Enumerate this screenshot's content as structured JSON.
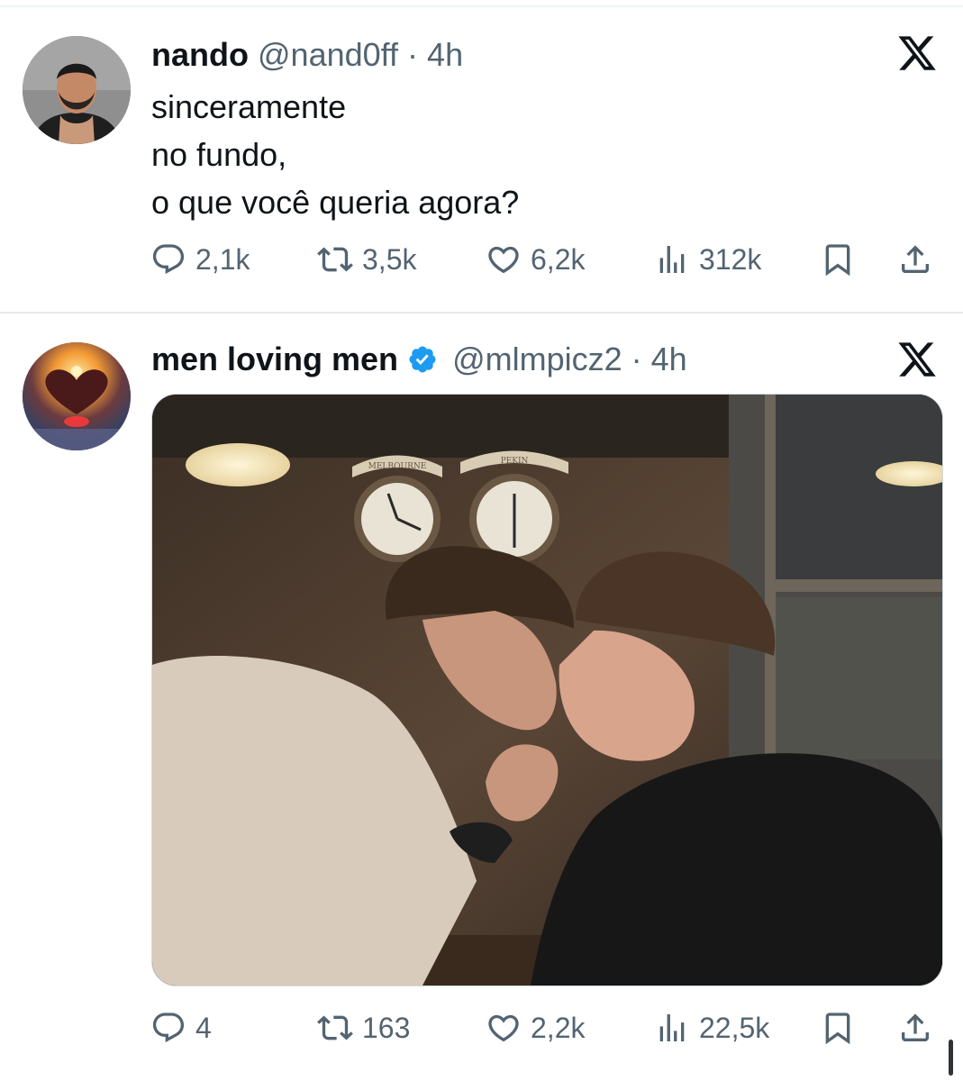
{
  "tweets": [
    {
      "author_name": "nando",
      "handle": "@nand0ff",
      "separator": "·",
      "time": "4h",
      "verified": false,
      "text_lines": [
        "sinceramente",
        "no fundo,",
        "o que você queria agora?"
      ],
      "stats": {
        "replies": "2,1k",
        "retweets": "3,5k",
        "likes": "6,2k",
        "views": "312k"
      }
    },
    {
      "author_name": "men loving men",
      "handle": "@mlmpicz2",
      "separator": "·",
      "time": "4h",
      "verified": true,
      "media": {
        "description_icon": "photo-icon",
        "clock_labels": [
          "MELBOURNE",
          "PEKIN"
        ]
      },
      "stats": {
        "replies": "4",
        "retweets": "163",
        "likes": "2,2k",
        "views": "22,5k"
      }
    }
  ],
  "icons": {
    "reply": "reply-icon",
    "retweet": "retweet-icon",
    "like": "heart-icon",
    "views": "views-icon",
    "bookmark": "bookmark-icon",
    "share": "share-icon",
    "brand": "x-logo-icon",
    "verified": "verified-badge-icon"
  },
  "colors": {
    "text": "#0f1419",
    "secondary": "#536471",
    "verified": "#1d9bf0",
    "divider": "#e7e9ea"
  }
}
